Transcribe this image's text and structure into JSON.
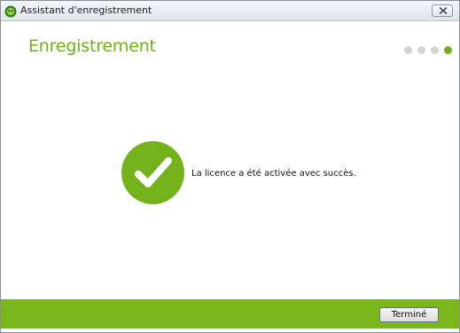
{
  "window": {
    "title": "Assistant d'enregistrement",
    "icon": "green-app-icon",
    "close_icon": "close-icon"
  },
  "header": {
    "title": "Enregistrement",
    "steps_total": 4,
    "active_step": 4
  },
  "content": {
    "status_icon": "checkmark-icon",
    "message": "La licence a été activée avec succès."
  },
  "footer": {
    "finish_label": "Terminé"
  },
  "colors": {
    "accent": "#72b01b",
    "footer": "#7ab71d",
    "inactive_dot": "#d4d4d4"
  }
}
